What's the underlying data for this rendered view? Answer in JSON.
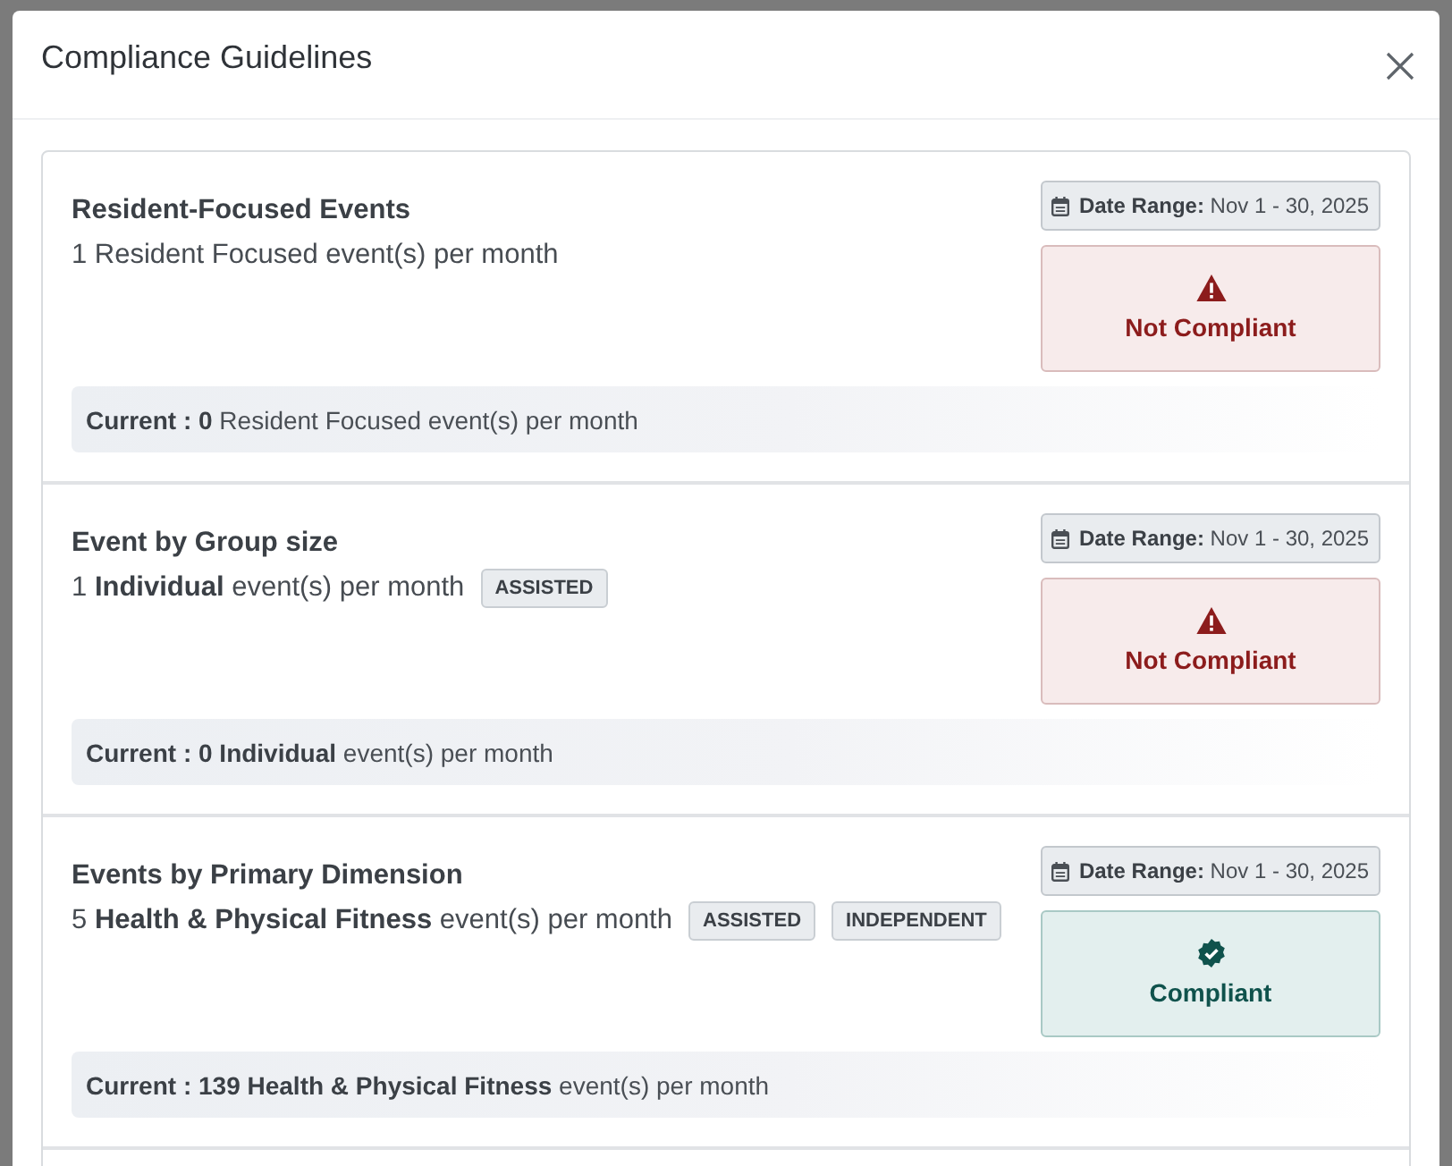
{
  "dialog": {
    "title": "Compliance Guidelines"
  },
  "guidelines": [
    {
      "title": "Resident-Focused Events",
      "requirement": "1 Resident Focused event(s) per month",
      "date_range": "**Date Range:** Nov 1 - 30, 2025",
      "status": {
        "compliant": false,
        "label": "Not Compliant"
      },
      "current": "**Current : 0** Resident Focused event(s) per month"
    },
    {
      "title": "Event by Group size",
      "requirement": "1 **Individual** event(s) per month",
      "tags": [
        "ASSISTED"
      ],
      "date_range": "**Date Range:** Nov 1 - 30, 2025",
      "status": {
        "compliant": false,
        "label": "Not Compliant"
      },
      "current": "**Current : 0 Individual** event(s) per month"
    },
    {
      "title": "Events by Primary Dimension",
      "requirement": "5 **Health & Physical Fitness** event(s) per month",
      "tags": [
        "ASSISTED",
        "INDEPENDENT"
      ],
      "date_range": "**Date Range:** Nov 1 - 30, 2025",
      "status": {
        "compliant": true,
        "label": "Compliant"
      },
      "current": "**Current : 139 Health & Physical Fitness** event(s) per month"
    }
  ]
}
